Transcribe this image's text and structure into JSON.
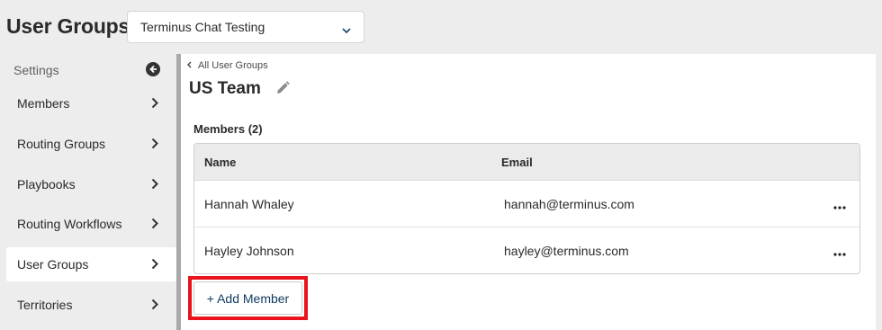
{
  "header": {
    "title": "User Groups",
    "selected_group": "Terminus Chat Testing"
  },
  "sidebar": {
    "section_label": "Settings",
    "items": [
      {
        "label": "Members"
      },
      {
        "label": "Routing Groups"
      },
      {
        "label": "Playbooks"
      },
      {
        "label": "Routing Workflows"
      },
      {
        "label": "User Groups",
        "active": true
      },
      {
        "label": "Territories"
      }
    ]
  },
  "main": {
    "breadcrumb": "All User Groups",
    "group_name": "US Team",
    "members_heading": "Members (2)",
    "table": {
      "columns": [
        "Name",
        "Email"
      ],
      "rows": [
        {
          "name": "Hannah Whaley",
          "email": "hannah@terminus.com"
        },
        {
          "name": "Hayley Johnson",
          "email": "hayley@terminus.com"
        }
      ]
    },
    "add_member_label": "+ Add Member"
  },
  "colors": {
    "highlight": "#e8131c",
    "button_text": "#0f3a5f",
    "sidebar_bg": "#ededed"
  }
}
